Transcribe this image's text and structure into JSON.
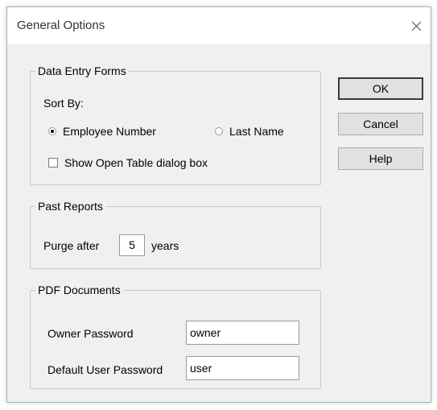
{
  "window": {
    "title": "General Options"
  },
  "data_entry_forms": {
    "legend": "Data Entry Forms",
    "sort_by_label": "Sort By:",
    "sort_options": [
      {
        "label": "Employee Number",
        "selected": true
      },
      {
        "label": "Last Name",
        "selected": false
      }
    ],
    "show_open_table": {
      "label": "Show Open Table dialog box",
      "checked": false
    }
  },
  "past_reports": {
    "legend": "Past Reports",
    "purge_prefix": "Purge after",
    "purge_value": "5",
    "purge_suffix": "years"
  },
  "pdf_documents": {
    "legend": "PDF Documents",
    "owner_label": "Owner Password",
    "owner_value": "owner",
    "user_label": "Default User Password",
    "user_value": "user"
  },
  "buttons": {
    "ok": "OK",
    "cancel": "Cancel",
    "help": "Help"
  }
}
